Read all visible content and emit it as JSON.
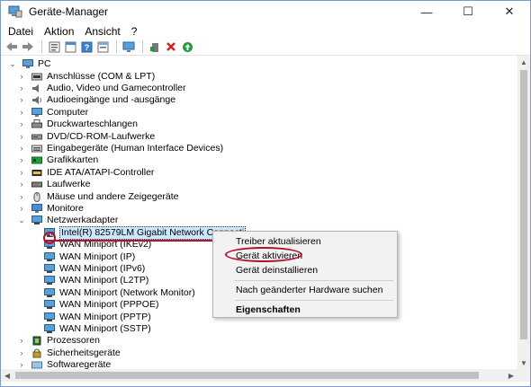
{
  "window": {
    "title": "Geräte-Manager",
    "minimize_glyph": "—",
    "maximize_glyph": "☐",
    "close_glyph": "✕"
  },
  "menu": [
    "Datei",
    "Aktion",
    "Ansicht",
    "?"
  ],
  "toolbar_icons": [
    "back-arrow-icon",
    "forward-arrow-icon",
    "properties-sheet-icon",
    "show-hidden-icon",
    "help-icon",
    "details-icon",
    "monitor-scan-icon",
    "add-driver-icon",
    "uninstall-x-icon",
    "update-driver-icon"
  ],
  "tree": {
    "root": "PC",
    "expand_collapsed": "›",
    "expand_open": "⌄",
    "categories": [
      {
        "label": "Anschlüsse (COM & LPT)",
        "icon": "port-icon"
      },
      {
        "label": "Audio, Video und Gamecontroller",
        "icon": "speaker-icon"
      },
      {
        "label": "Audioeingänge und -ausgänge",
        "icon": "audio-io-icon"
      },
      {
        "label": "Computer",
        "icon": "computer-icon"
      },
      {
        "label": "Druckwarteschlangen",
        "icon": "printer-icon"
      },
      {
        "label": "DVD/CD-ROM-Laufwerke",
        "icon": "dvd-drive-icon"
      },
      {
        "label": "Eingabegeräte (Human Interface Devices)",
        "icon": "hid-icon"
      },
      {
        "label": "Grafikkarten",
        "icon": "display-adapter-icon"
      },
      {
        "label": "IDE ATA/ATAPI-Controller",
        "icon": "ide-controller-icon"
      },
      {
        "label": "Laufwerke",
        "icon": "disk-drive-icon"
      },
      {
        "label": "Mäuse und andere Zeigegeräte",
        "icon": "mouse-icon"
      },
      {
        "label": "Monitore",
        "icon": "monitor-icon"
      },
      {
        "label": "Netzwerkadapter",
        "icon": "network-adapter-icon",
        "expanded": true
      }
    ],
    "network_children": [
      "Intel(R) 82579LM Gigabit Network Connecti",
      "WAN Miniport (IKEv2)",
      "WAN Miniport (IP)",
      "WAN Miniport (IPv6)",
      "WAN Miniport (L2TP)",
      "WAN Miniport (Network Monitor)",
      "WAN Miniport (PPPOE)",
      "WAN Miniport (PPTP)",
      "WAN Miniport (SSTP)"
    ],
    "after": [
      {
        "label": "Prozessoren",
        "icon": "processor-icon"
      },
      {
        "label": "Sicherheitsgeräte",
        "icon": "security-device-icon"
      },
      {
        "label": "Softwaregeräte",
        "icon": "software-device-icon"
      }
    ]
  },
  "context_menu": {
    "update_driver": "Treiber aktualisieren",
    "enable_device": "Gerät aktivieren",
    "uninstall_device": "Gerät deinstallieren",
    "scan_hardware": "Nach geänderter Hardware suchen",
    "properties": "Eigenschaften"
  },
  "colors": {
    "annotation_red": "#b3122e",
    "selection_blue": "#cce8ff",
    "accent_green": "#1e9e3a",
    "error_red": "#d21f1f"
  }
}
